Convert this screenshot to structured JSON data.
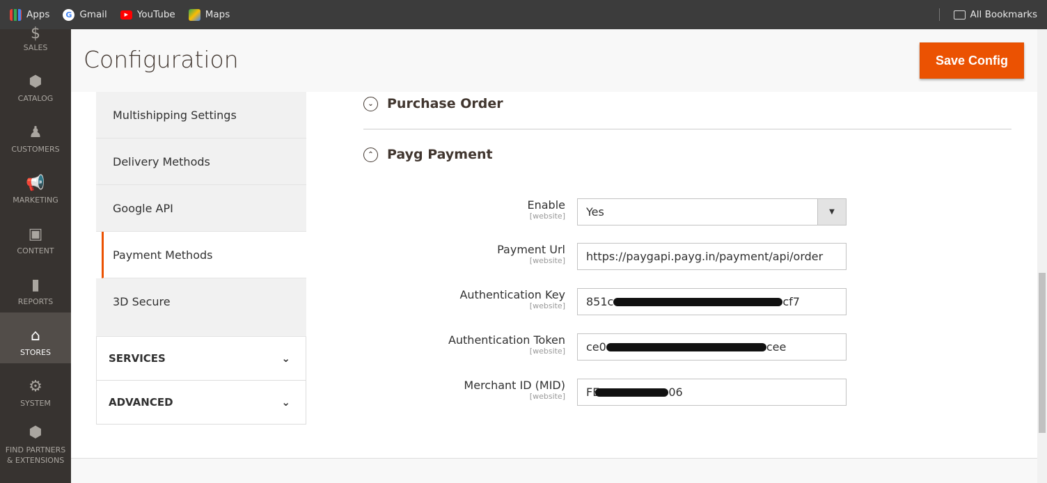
{
  "bookmarks": {
    "items": [
      {
        "label": "Apps",
        "icon": "apps-grid-icon"
      },
      {
        "label": "Gmail",
        "icon": "google-icon"
      },
      {
        "label": "YouTube",
        "icon": "youtube-icon"
      },
      {
        "label": "Maps",
        "icon": "maps-icon"
      }
    ],
    "all_bookmarks": "All Bookmarks"
  },
  "sidebar": {
    "items": [
      {
        "label": "SALES",
        "icon": "dollar-icon"
      },
      {
        "label": "CATALOG",
        "icon": "box-icon"
      },
      {
        "label": "CUSTOMERS",
        "icon": "person-icon"
      },
      {
        "label": "MARKETING",
        "icon": "megaphone-icon"
      },
      {
        "label": "CONTENT",
        "icon": "layout-icon"
      },
      {
        "label": "REPORTS",
        "icon": "bar-chart-icon"
      },
      {
        "label": "STORES",
        "icon": "store-icon",
        "active": true
      },
      {
        "label": "SYSTEM",
        "icon": "gear-icon"
      },
      {
        "label": "FIND PARTNERS & EXTENSIONS",
        "icon": "blocks-icon"
      }
    ]
  },
  "header": {
    "title": "Configuration",
    "save_label": "Save Config"
  },
  "config_nav": {
    "items": [
      "Multishipping Settings",
      "Delivery Methods",
      "Google API",
      "Payment Methods",
      "3D Secure"
    ],
    "active": "Payment Methods",
    "sections": [
      "SERVICES",
      "ADVANCED"
    ]
  },
  "groups": {
    "purchase_order": "Purchase Order",
    "payg": "Payg Payment"
  },
  "fields": [
    {
      "label": "Enable",
      "scope": "[website]",
      "value": "Yes",
      "type": "select"
    },
    {
      "label": "Payment Url",
      "scope": "[website]",
      "value": "https://paygapi.payg.in/payment/api/order"
    },
    {
      "label": "Authentication Key",
      "scope": "[website]",
      "prefix": "851c",
      "suffix": "cf7",
      "redacted": true
    },
    {
      "label": "Authentication Token",
      "scope": "[website]",
      "prefix": "ce0",
      "suffix": "cee",
      "redacted": true
    },
    {
      "label": "Merchant ID (MID)",
      "scope": "[website]",
      "prefix": "FE",
      "suffix": "06",
      "redacted": true
    }
  ],
  "colors": {
    "accent": "#eb5202",
    "sidebar": "#373330"
  }
}
